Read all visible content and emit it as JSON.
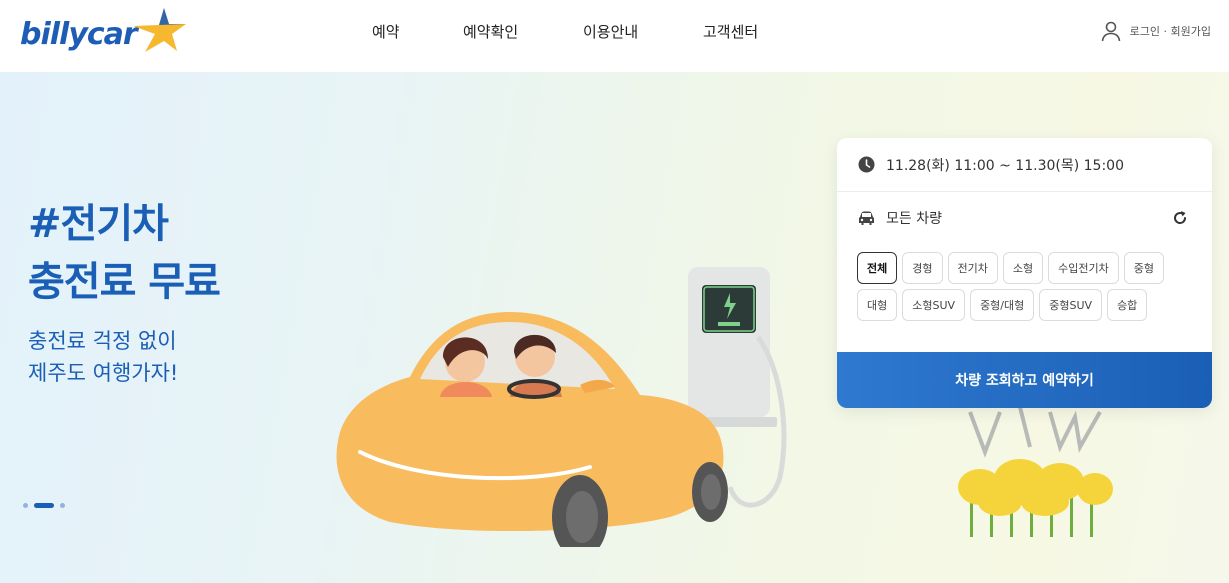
{
  "brand": {
    "name": "billycar"
  },
  "nav": {
    "items": [
      "예약",
      "예약확인",
      "이용안내",
      "고객센터"
    ]
  },
  "user": {
    "links": "로그인 · 회원가입"
  },
  "hero": {
    "title_line1": "#전기차",
    "title_line2": "충전료 무료",
    "sub_line1": "충전료 걱정 없이",
    "sub_line2": "제주도 여행가자!",
    "slide_dots": 3,
    "active_slide": 2
  },
  "booking": {
    "datetime": "11.28(화) 11:00 ~ 11.30(목) 15:00",
    "vehicle_label": "모든 차량",
    "chips": [
      "전체",
      "경형",
      "전기차",
      "소형",
      "수입전기차",
      "중형",
      "대형",
      "소형SUV",
      "중형/대형",
      "중형SUV",
      "승합"
    ],
    "active_chip": "전체",
    "cta": "차량 조회하고 예약하기"
  },
  "colors": {
    "brand_blue": "#1a5fb5",
    "star_yellow": "#f5b82e",
    "car_orange": "#f8bb5e"
  }
}
